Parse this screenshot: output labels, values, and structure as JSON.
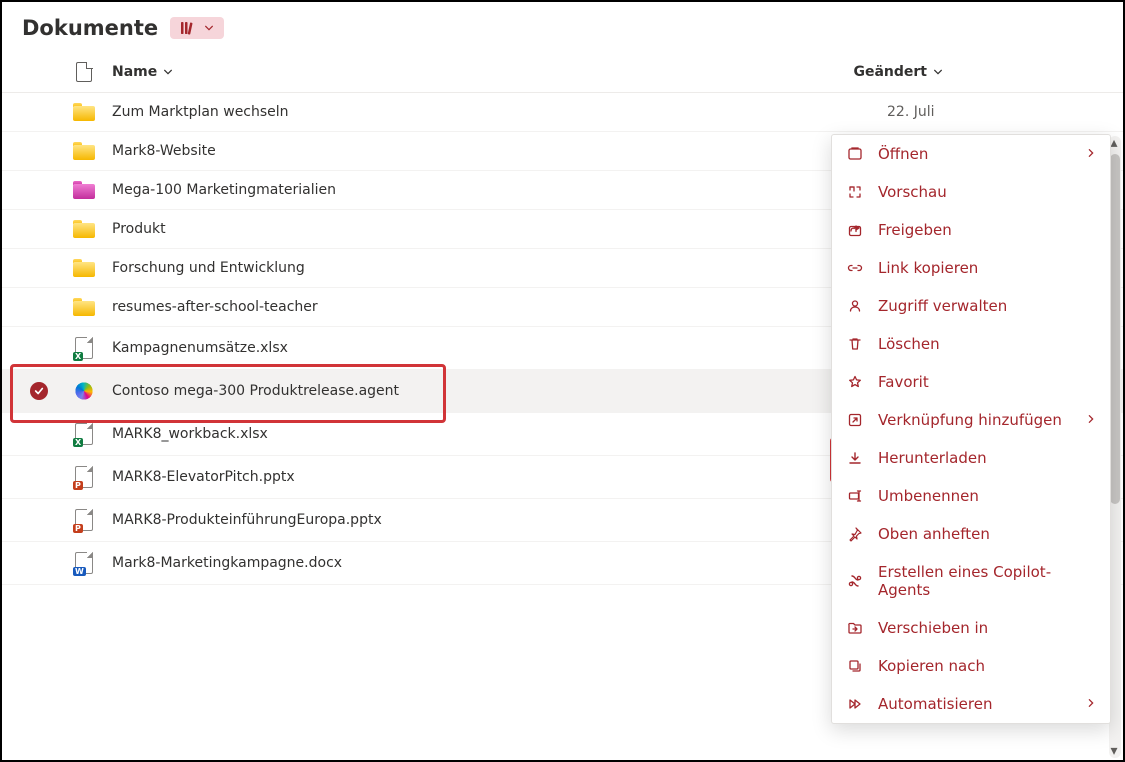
{
  "header": {
    "title": "Dokumente"
  },
  "columns": {
    "name": "Name",
    "modified": "Geändert"
  },
  "rows": [
    {
      "type": "folder",
      "name": "Zum Marktplan wechseln",
      "modified": "22. Juli"
    },
    {
      "type": "folder",
      "name": "Mark8-Website",
      "modified": ""
    },
    {
      "type": "folder-pink",
      "name": "Mega-100 Marketingmaterialien",
      "modified": ""
    },
    {
      "type": "folder",
      "name": "Produkt",
      "modified": ""
    },
    {
      "type": "folder",
      "name": "Forschung und Entwicklung",
      "modified": ""
    },
    {
      "type": "folder",
      "name": "resumes-after-school-teacher",
      "modified": ""
    },
    {
      "type": "xlsx",
      "name": "Kampagnenumsätze.xlsx",
      "modified": ""
    },
    {
      "type": "agent",
      "name": "Contoso mega-300 Produktrelease.agent",
      "modified": "",
      "selected": true,
      "showDots": true
    },
    {
      "type": "xlsx",
      "name": "MARK8_workback.xlsx",
      "modified": ""
    },
    {
      "type": "pptx",
      "name": "MARK8-ElevatorPitch.pptx",
      "modified": ""
    },
    {
      "type": "pptx",
      "name": "MARK8-ProdukteinführungEuropa.pptx",
      "modified": ""
    },
    {
      "type": "docx",
      "name": "Mark8-Marketingkampagne.docx",
      "modified": ""
    }
  ],
  "menu": [
    {
      "icon": "open",
      "label": "Öffnen",
      "chevron": true
    },
    {
      "icon": "preview",
      "label": "Vorschau"
    },
    {
      "icon": "share",
      "label": "Freigeben"
    },
    {
      "icon": "link",
      "label": "Link kopieren"
    },
    {
      "icon": "access",
      "label": "Zugriff verwalten"
    },
    {
      "icon": "delete",
      "label": "Löschen"
    },
    {
      "icon": "favorite",
      "label": "Favorit"
    },
    {
      "icon": "shortcut",
      "label": "Verknüpfung hinzufügen",
      "chevron": true
    },
    {
      "icon": "download",
      "label": "Herunterladen",
      "highlight": true
    },
    {
      "icon": "rename",
      "label": "Umbenennen"
    },
    {
      "icon": "pin",
      "label": "Oben anheften"
    },
    {
      "icon": "copilot",
      "label": "Erstellen eines Copilot-Agents"
    },
    {
      "icon": "move",
      "label": "Verschieben in"
    },
    {
      "icon": "copy",
      "label": "Kopieren nach"
    },
    {
      "icon": "automate",
      "label": "Automatisieren",
      "chevron": true
    }
  ]
}
